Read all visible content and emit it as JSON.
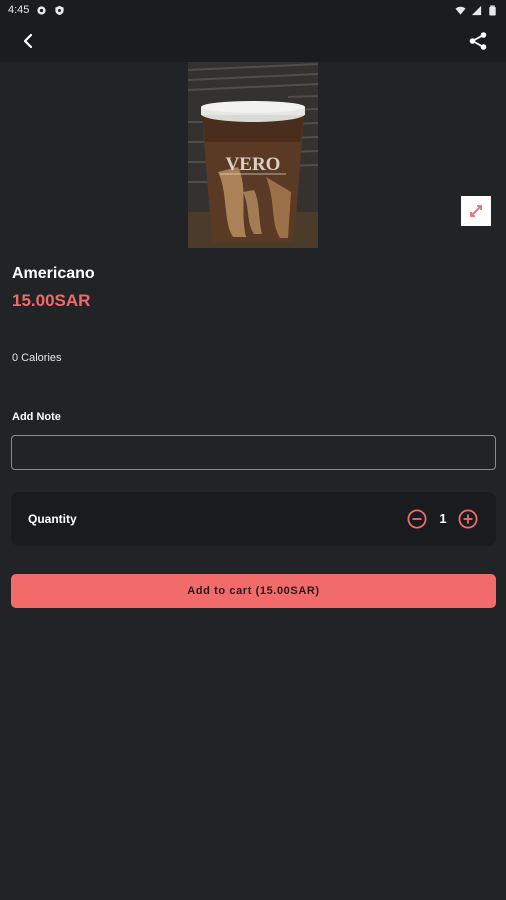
{
  "status_bar": {
    "time": "4:45"
  },
  "product": {
    "name": "Americano",
    "price": "15.00SAR",
    "calories": "0 Calories",
    "cup_text": "VERO"
  },
  "note": {
    "label": "Add Note",
    "value": "",
    "placeholder": ""
  },
  "quantity": {
    "label": "Quantity",
    "value": "1"
  },
  "cart": {
    "label": "Add to cart (15.00SAR)"
  },
  "colors": {
    "accent": "#f26b6b",
    "background": "#222327",
    "card": "#1a1b1e"
  },
  "icons": {
    "back": "arrow-left-icon",
    "share": "share-icon",
    "expand": "expand-icon",
    "minus": "minus-circle-icon",
    "plus": "plus-circle-icon"
  }
}
